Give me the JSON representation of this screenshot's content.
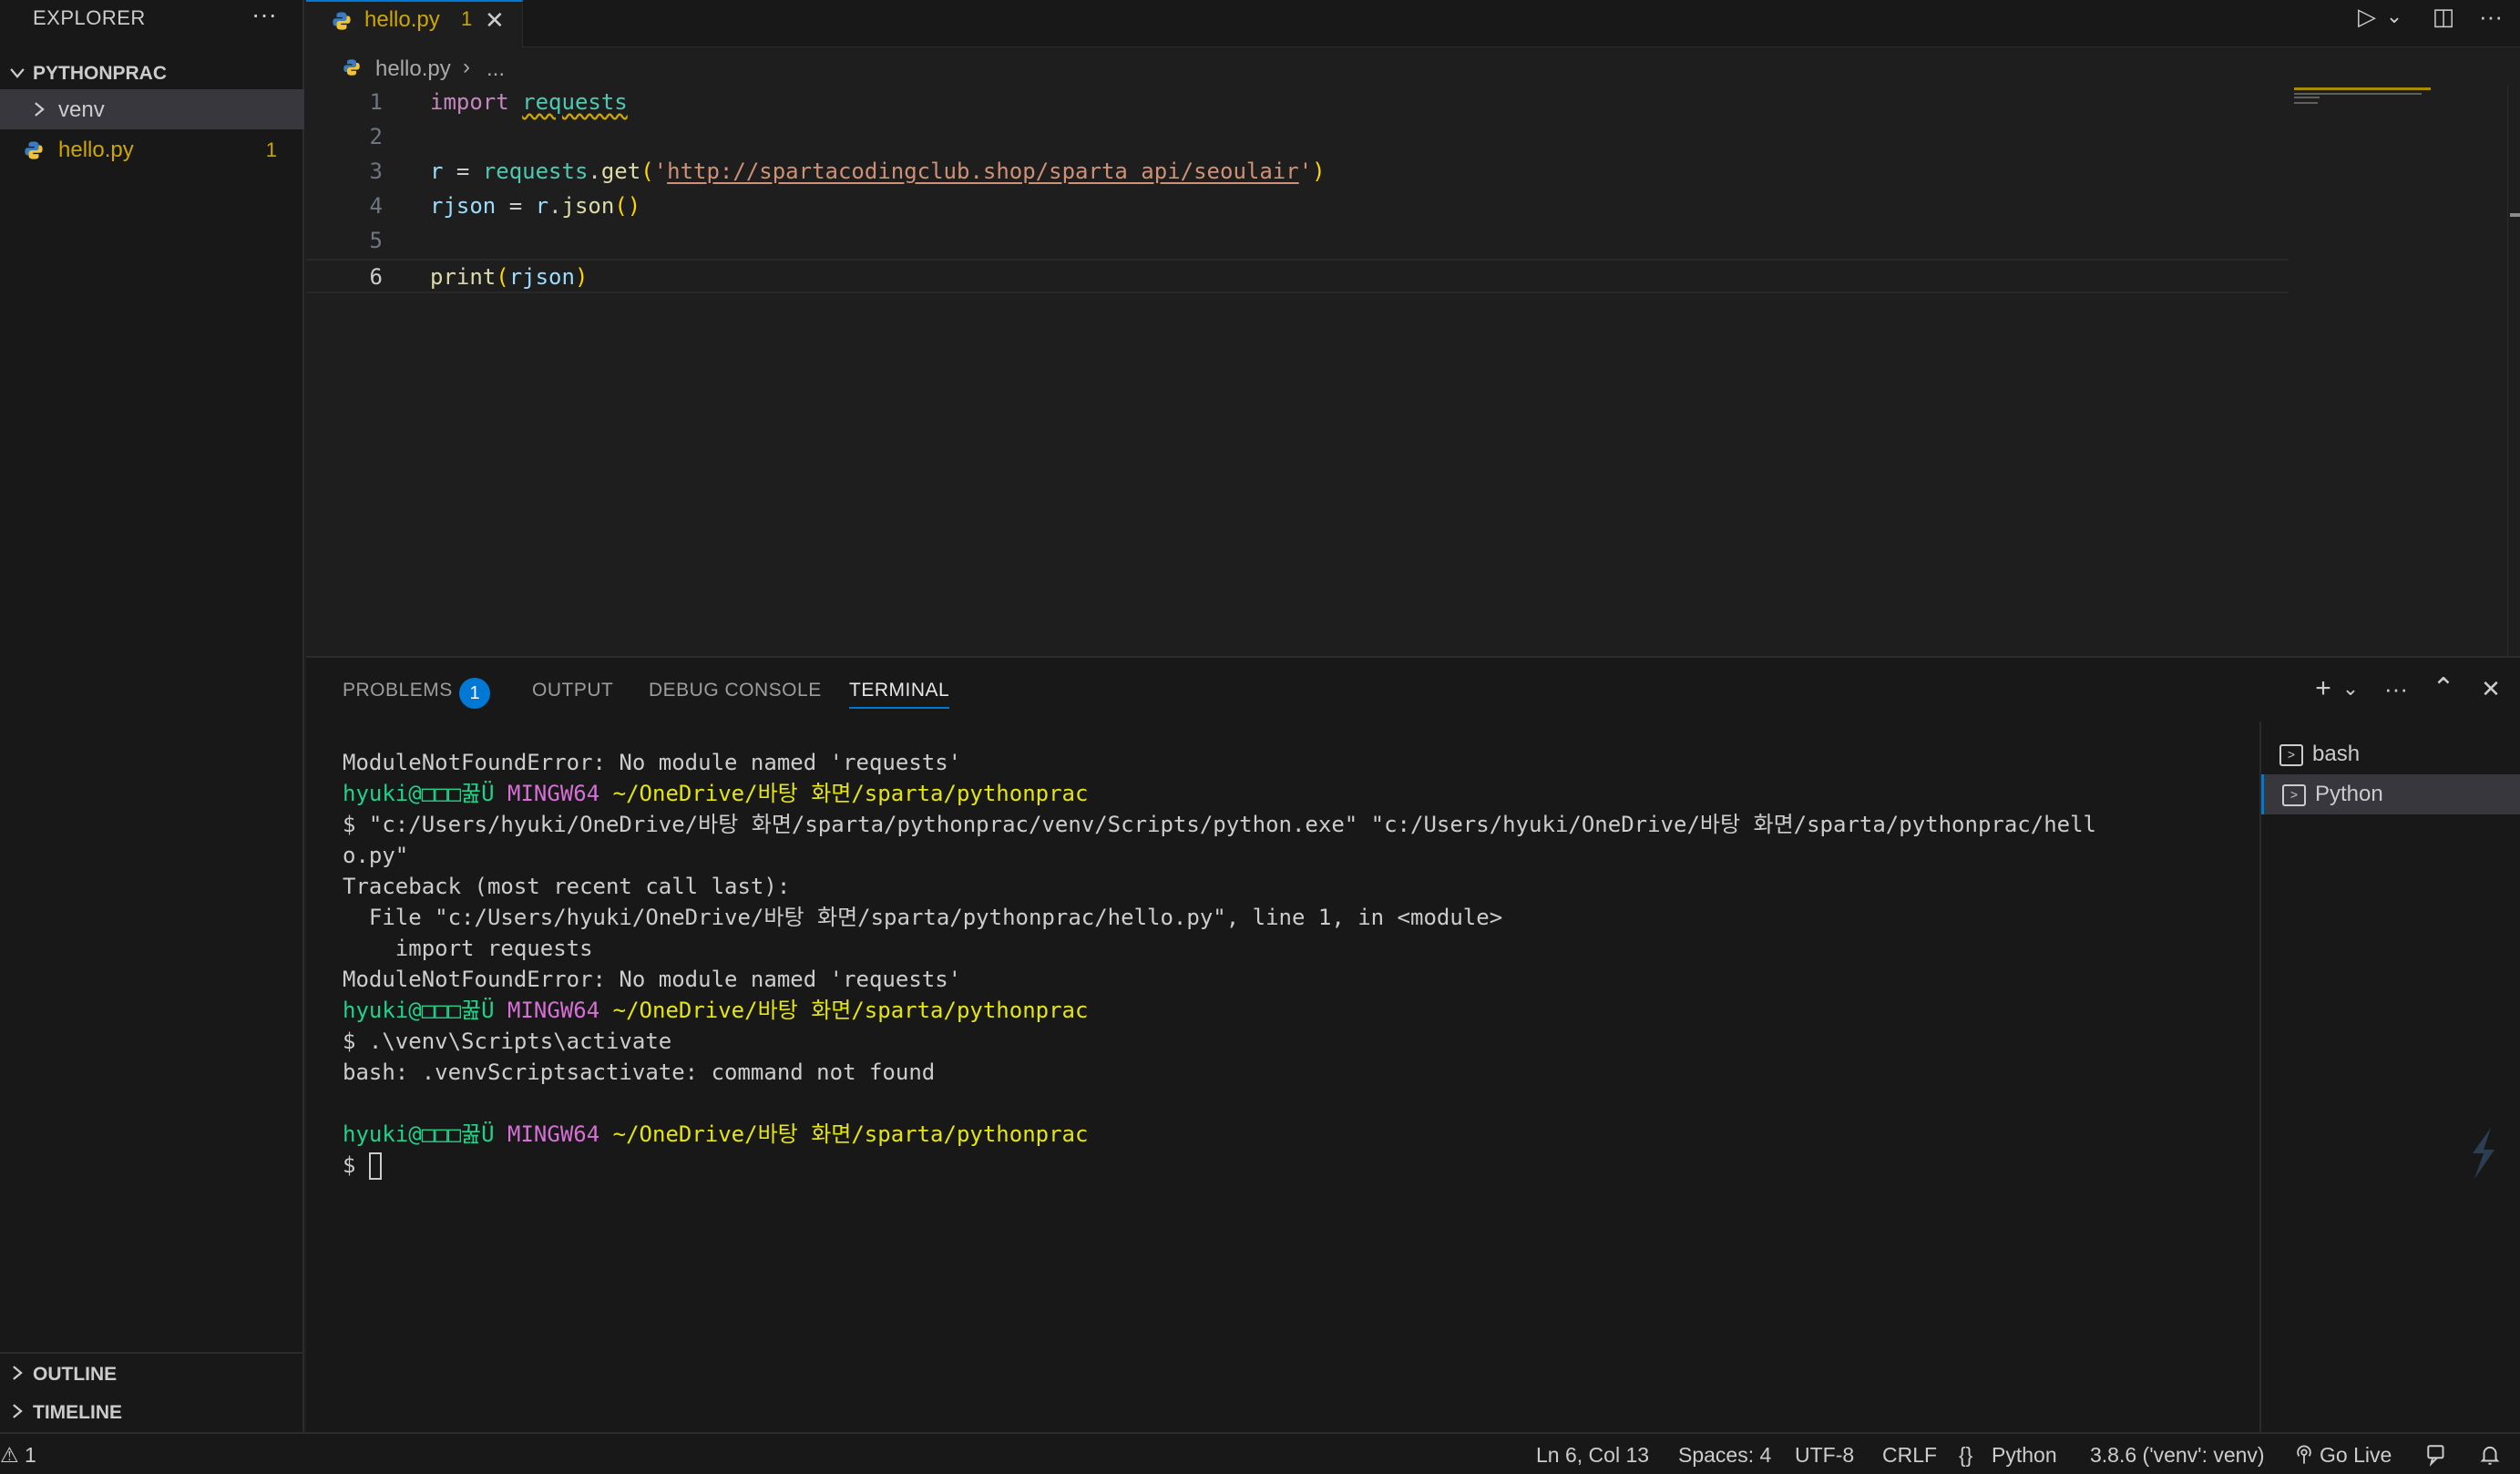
{
  "sidebar": {
    "title": "EXPLORER",
    "more": "···",
    "project": "PYTHONPRAC",
    "items": [
      {
        "label": "venv"
      },
      {
        "label": "hello.py",
        "badge": "1"
      }
    ],
    "outline": "OUTLINE",
    "timeline": "TIMELINE"
  },
  "tabs": [
    {
      "label": "hello.py",
      "count": "1",
      "close": "✕"
    }
  ],
  "toolbar": {
    "run": "▷",
    "run_more": "⌄",
    "split": "◫",
    "more": "···"
  },
  "breadcrumb": {
    "file": "hello.py",
    "sep": "›",
    "more": "..."
  },
  "editor": {
    "line_numbers": [
      "1",
      "2",
      "3",
      "4",
      "5",
      "6"
    ],
    "line1": {
      "kw": "import",
      "mod": "requests"
    },
    "line3": {
      "r": "r",
      "eq": " = ",
      "mod": "requests",
      "dot": ".",
      "fn": "get",
      "p1": "(",
      "q1": "'",
      "url": "http://spartacodingclub.shop/sparta_api/seoulair",
      "q2": "'",
      "p2": ")"
    },
    "line4": {
      "var": "rjson",
      "eq": " = ",
      "r": "r",
      "dot": ".",
      "fn": "json",
      "parens": "()"
    },
    "line6": {
      "fn": "print",
      "p1": "(",
      "var": "rjson",
      "p2": ")"
    }
  },
  "panel": {
    "tabs": [
      "PROBLEMS",
      "OUTPUT",
      "DEBUG CONSOLE",
      "TERMINAL"
    ],
    "problems_count": "1",
    "actions": {
      "add": "+",
      "add_more": "⌄",
      "more": "···",
      "maximize": "⌃",
      "close": "✕"
    }
  },
  "terminal": {
    "l1": "ModuleNotFoundError: No module named 'requests'",
    "user": "hyuki@□□□꿆Ü",
    "host": "MINGW64",
    "path": "~/OneDrive/바탕 화면/sparta/pythonprac",
    "cmd1": "$ \"c:/Users/hyuki/OneDrive/바탕 화면/sparta/pythonprac/venv/Scripts/python.exe\" \"c:/Users/hyuki/OneDrive/바탕 화면/sparta/pythonprac/hell",
    "cmd1b": "o.py\"",
    "tb1": "Traceback (most recent call last):",
    "tb2": "  File \"c:/Users/hyuki/OneDrive/바탕 화면/sparta/pythonprac/hello.py\", line 1, in <module>",
    "tb3": "    import requests",
    "tb4": "ModuleNotFoundError: No module named 'requests'",
    "cmd2": "$ .\\venv\\Scripts\\activate",
    "err": "bash: .venvScriptsactivate: command not found",
    "prompt": "$ "
  },
  "terminal_list": [
    {
      "label": "bash"
    },
    {
      "label": "Python"
    }
  ],
  "statusbar": {
    "problems": "⚠ 1",
    "position": "Ln 6, Col 13",
    "spaces": "Spaces: 4",
    "encoding": "UTF-8",
    "eol": "CRLF",
    "lang_icon": "{}",
    "language": "Python",
    "interpreter": "3.8.6 ('venv': venv)",
    "golive": "Go Live"
  },
  "colors": {
    "accent": "#0078d4",
    "warning": "#cca700",
    "background": "#1e1e1e",
    "sidebar": "#181818"
  }
}
